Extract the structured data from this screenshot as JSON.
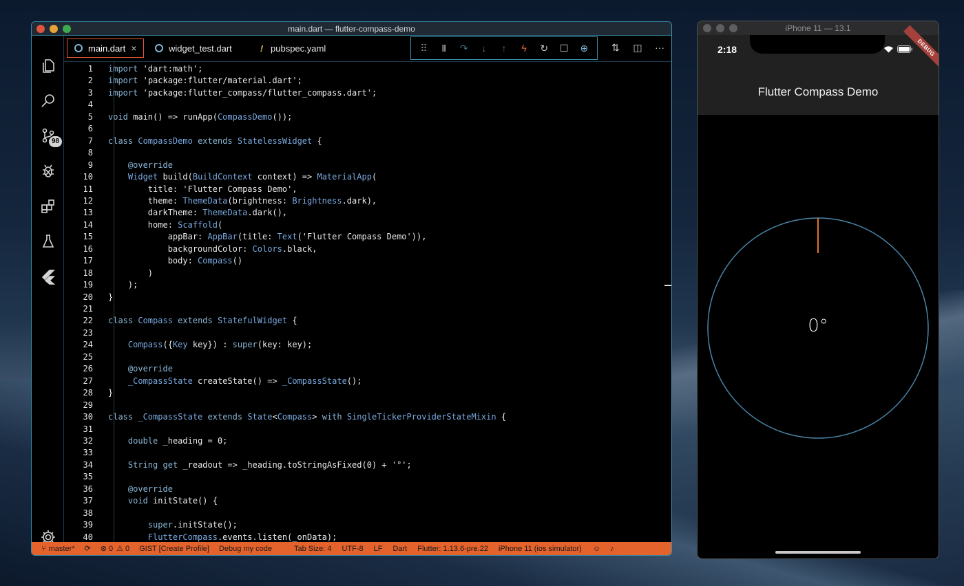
{
  "vscode": {
    "title": "main.dart — flutter-compass-demo",
    "scm_badge": "98",
    "tabs": [
      {
        "label": "main.dart",
        "close": "×"
      },
      {
        "label": "widget_test.dart"
      },
      {
        "label": "pubspec.yaml"
      }
    ],
    "code_lines": [
      "import 'dart:math';",
      "import 'package:flutter/material.dart';",
      "import 'package:flutter_compass/flutter_compass.dart';",
      "",
      "void main() => runApp(CompassDemo());",
      "",
      "class CompassDemo extends StatelessWidget {",
      "",
      "    @override",
      "    Widget build(BuildContext context) => MaterialApp(",
      "        title: 'Flutter Compass Demo',",
      "        theme: ThemeData(brightness: Brightness.dark),",
      "        darkTheme: ThemeData.dark(),",
      "        home: Scaffold(",
      "            appBar: AppBar(title: Text('Flutter Compass Demo')),",
      "            backgroundColor: Colors.black,",
      "            body: Compass()",
      "        )",
      "    );",
      "}",
      "",
      "class Compass extends StatefulWidget {",
      "",
      "    Compass({Key key}) : super(key: key);",
      "",
      "    @override",
      "    _CompassState createState() => _CompassState();",
      "}",
      "",
      "class _CompassState extends State<Compass> with SingleTickerProviderStateMixin {",
      "",
      "    double _heading = 0;",
      "",
      "    String get _readout => _heading.toStringAsFixed(0) + '°';",
      "",
      "    @override",
      "    void initState() {",
      "",
      "        super.initState();",
      "        FlutterCompass.events.listen(_onData);"
    ],
    "status": {
      "branch": "master*",
      "errors": "0",
      "warnings": "0",
      "gist": "GIST [Create Profile]",
      "debug": "Debug my code",
      "tab_size": "Tab Size: 4",
      "encoding": "UTF-8",
      "eol": "LF",
      "language": "Dart",
      "flutter": "Flutter: 1.13.6-pre.22",
      "device": "iPhone 11 (ios simulator)"
    },
    "colors": {
      "accent": "#e4622b",
      "border": "#3b8ea8"
    }
  },
  "simulator": {
    "title": "iPhone 11 — 13.1",
    "time": "2:18",
    "debug_ribbon": "DEBUG",
    "app_title": "Flutter Compass Demo",
    "heading": 0,
    "readout": "0°",
    "colors": {
      "circle": "#4a86a8",
      "needle": "#e0762e"
    }
  }
}
